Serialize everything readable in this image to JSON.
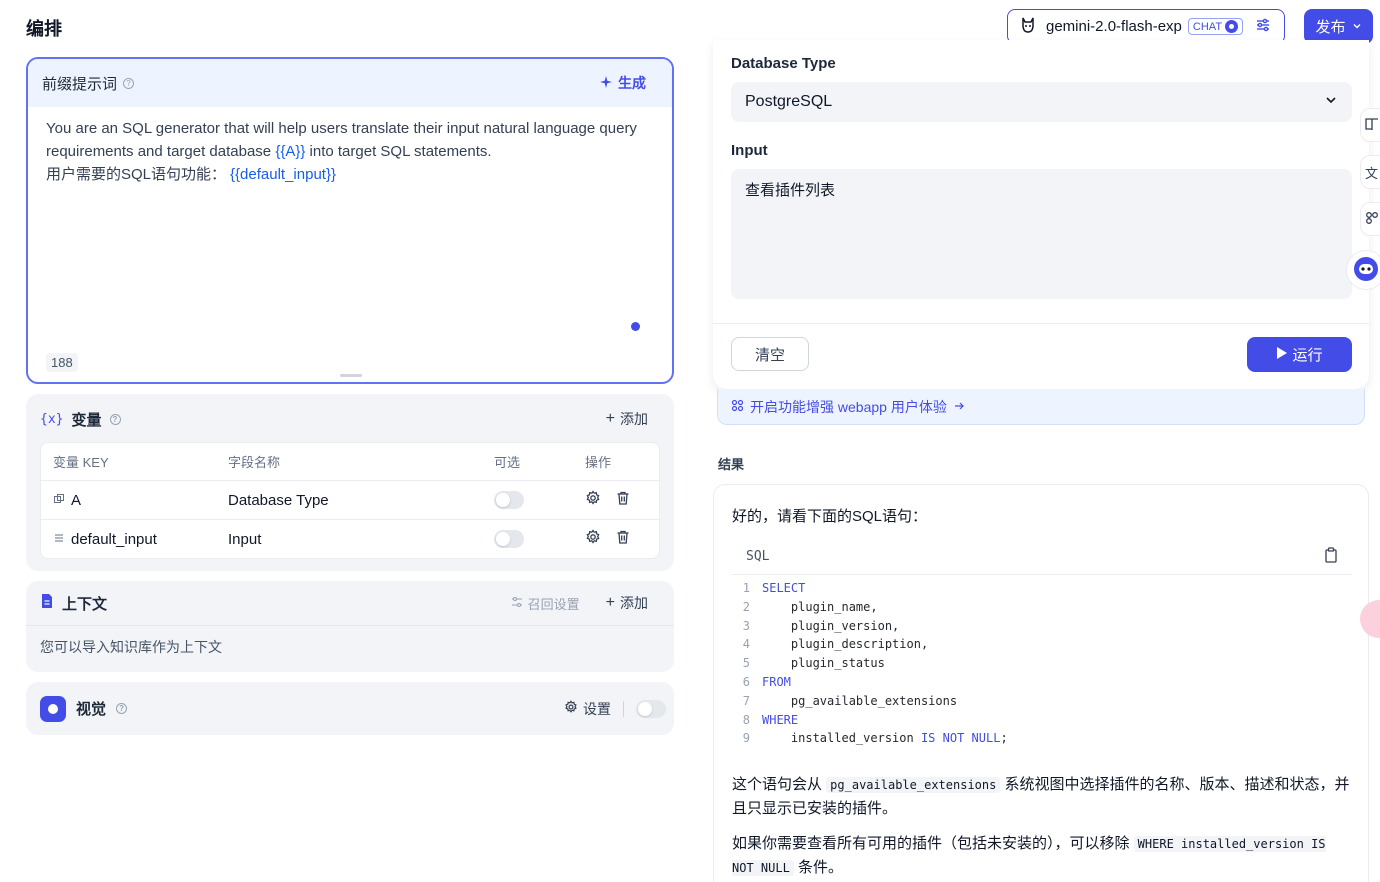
{
  "header": {
    "title": "编排",
    "model_name": "gemini-2.0-flash-exp",
    "model_badge": "CHAT",
    "publish_label": "发布"
  },
  "prompt": {
    "label": "前缀提示词",
    "generate_label": "生成",
    "line1": "You are an SQL generator that will help users translate their input natural language query requirements and target database ",
    "var_a": "{{A}}",
    "line1_tail": " into target SQL statements.",
    "line2": "用户需要的SQL语句功能：",
    "var_default": "{{default_input}}",
    "char_count": "188"
  },
  "variables": {
    "title": "变量",
    "add_label": "添加",
    "columns": [
      "变量 KEY",
      "字段名称",
      "可选",
      "操作"
    ],
    "rows": [
      {
        "key": "A",
        "field": "Database Type",
        "optional": false
      },
      {
        "key": "default_input",
        "field": "Input",
        "optional": false
      }
    ]
  },
  "context": {
    "title": "上下文",
    "recall_label": "召回设置",
    "add_label": "添加",
    "hint": "您可以导入知识库作为上下文"
  },
  "vision": {
    "title": "视觉",
    "settings_label": "设置",
    "enabled": false
  },
  "debug": {
    "db_label": "Database Type",
    "db_value": "PostgreSQL",
    "input_label": "Input",
    "input_value": "查看插件列表",
    "clear_label": "清空",
    "run_label": "运行",
    "enhance_text": "开启功能增强 webapp 用户体验"
  },
  "result": {
    "label": "结果",
    "intro": "好的，请看下面的SQL语句：",
    "code_lang": "SQL",
    "code_lines": [
      {
        "n": "1",
        "kw": "SELECT",
        "text": ""
      },
      {
        "n": "2",
        "kw": "",
        "text": "    plugin_name,"
      },
      {
        "n": "3",
        "kw": "",
        "text": "    plugin_version,"
      },
      {
        "n": "4",
        "kw": "",
        "text": "    plugin_description,"
      },
      {
        "n": "5",
        "kw": "",
        "text": "    plugin_status"
      },
      {
        "n": "6",
        "kw": "FROM",
        "text": ""
      },
      {
        "n": "7",
        "kw": "",
        "text": "    pg_available_extensions"
      },
      {
        "n": "8",
        "kw": "WHERE",
        "text": ""
      },
      {
        "n": "9",
        "kw": "",
        "text": "    installed_version IS NOT NULL;"
      }
    ],
    "p1_a": "这个语句会从 ",
    "p1_code": "pg_available_extensions",
    "p1_b": " 系统视图中选择插件的名称、版本、描述和状态，并且只显示已安装的插件。",
    "p2_a": "如果你需要查看所有可用的插件（包括未安装的），可以移除 ",
    "p2_code": "WHERE installed_version IS NOT NULL",
    "p2_b": " 条件。"
  },
  "colors": {
    "accent": "#444ce7",
    "variable": "#155eef"
  }
}
